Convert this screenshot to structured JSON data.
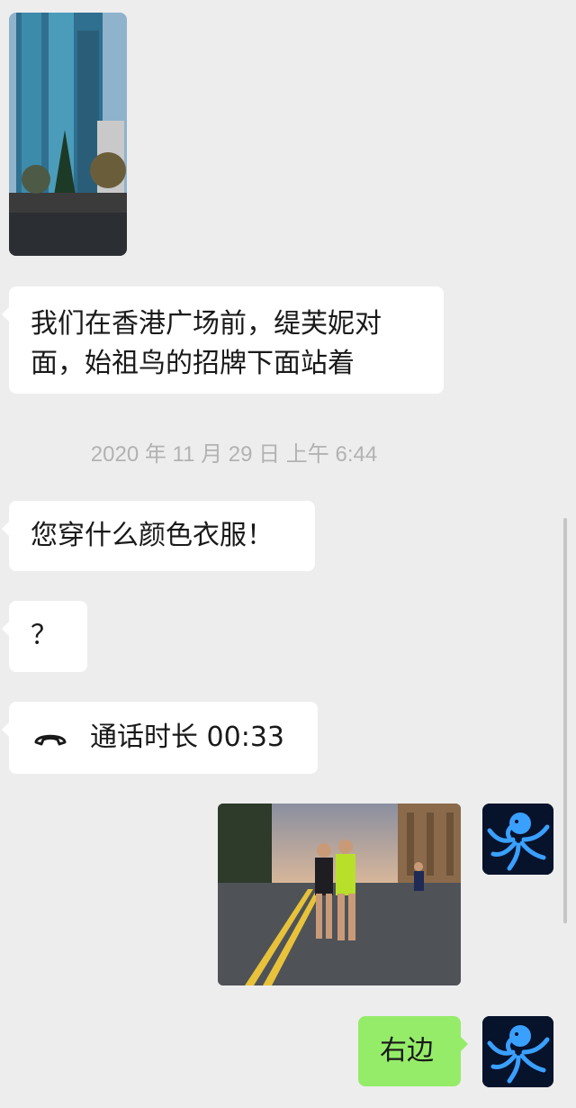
{
  "chat": {
    "messages": [
      {
        "from": "them",
        "type": "image",
        "image_icon": "building-photo-icon"
      },
      {
        "from": "them",
        "type": "text",
        "line1": "我们在香港广场前，缇芙妮对",
        "line2": "面，始祖鸟的招牌下面站着"
      },
      {
        "type": "timestamp",
        "text": "2020 年 11 月 29 日 上午 6:44"
      },
      {
        "from": "them",
        "type": "text",
        "text": "您穿什么颜色衣服！"
      },
      {
        "from": "them",
        "type": "text",
        "text": "？"
      },
      {
        "from": "them",
        "type": "call",
        "icon": "phone-hangup-icon",
        "text": "通话时长 00:33"
      },
      {
        "from": "me",
        "type": "image",
        "image_icon": "runners-photo-icon"
      },
      {
        "from": "me",
        "type": "text",
        "text": "右边"
      }
    ],
    "avatar_icon": "octopus-icon"
  },
  "colors": {
    "background": "#ededed",
    "incoming_bubble": "#ffffff",
    "outgoing_bubble": "#95ec69",
    "timestamp": "#b2b2b2",
    "avatar_bg": "#07122b",
    "avatar_octopus": "#3aa0ff"
  }
}
